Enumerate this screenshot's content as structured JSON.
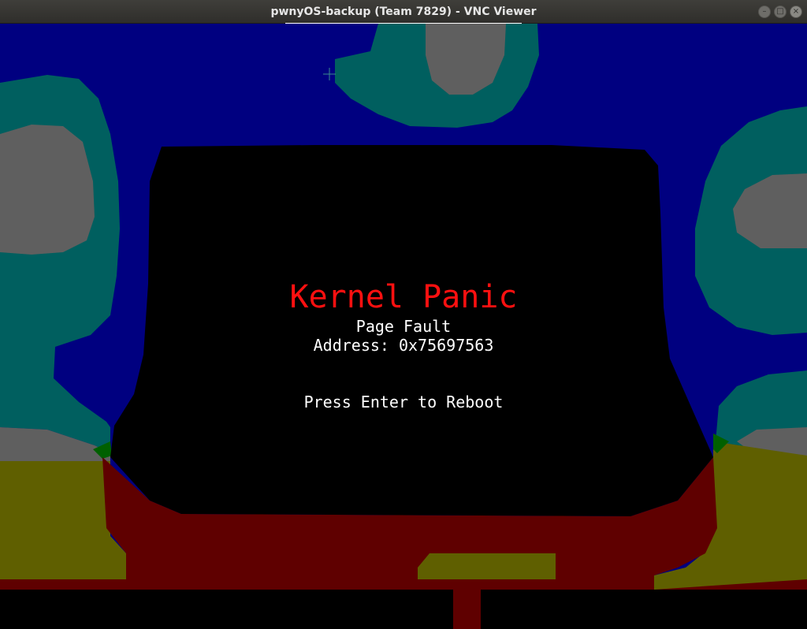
{
  "window": {
    "title": "pwnyOS-backup (Team 7829) - VNC Viewer",
    "controls": {
      "minimize": "–",
      "maximize": "□",
      "close": "×"
    }
  },
  "panic": {
    "title": "Kernel Panic",
    "reason": "Page Fault",
    "address": "Address: 0x75697563",
    "prompt": "Press Enter to Reboot"
  },
  "colors": {
    "navy": "#000080",
    "teal": "#005f5f",
    "gray": "#5f5f5f",
    "olive": "#5f5f00",
    "maroon": "#5f0000",
    "green": "#006000",
    "black": "#000000",
    "panic_red": "#ff1010",
    "text": "#ffffff"
  }
}
